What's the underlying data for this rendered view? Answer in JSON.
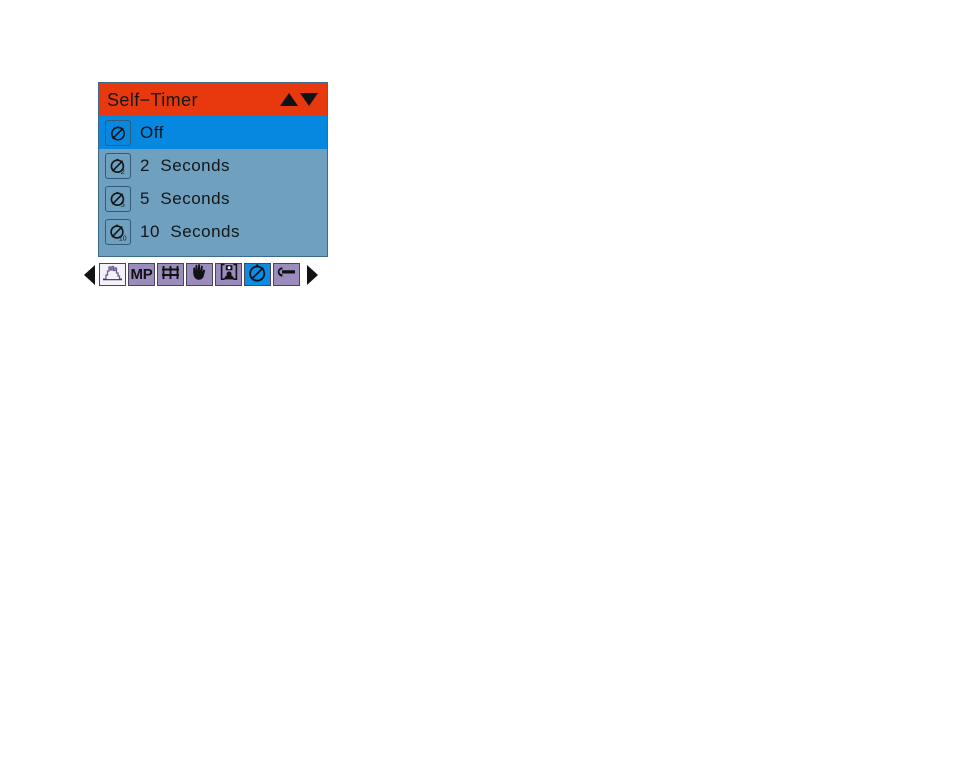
{
  "panel": {
    "title": "Self−Timer",
    "header_color": "#e8380d",
    "body_color": "#6fa0c0",
    "selected_row_color": "#0688e0",
    "scroll_up_icon": "triangle-up-icon",
    "scroll_down_icon": "triangle-down-icon",
    "options": [
      {
        "label": "Off",
        "icon": "self-timer-off-icon",
        "badge": "",
        "selected": true
      },
      {
        "label": "2  Seconds",
        "icon": "self-timer-2s-icon",
        "badge": "2",
        "selected": false
      },
      {
        "label": "5  Seconds",
        "icon": "self-timer-5s-icon",
        "badge": "5",
        "selected": false
      },
      {
        "label": "10  Seconds",
        "icon": "self-timer-10s-icon",
        "badge": "10",
        "selected": false
      }
    ]
  },
  "tab_strip": {
    "prev_label": "◀",
    "next_label": "▶",
    "tabs": [
      {
        "name": "tab-histogram",
        "icon": "histogram-icon",
        "text": "",
        "state": "active-white"
      },
      {
        "name": "tab-mp",
        "icon": "mp-label-icon",
        "text": "MP",
        "state": "normal"
      },
      {
        "name": "tab-rail",
        "icon": "rail-grid-icon",
        "text": "",
        "state": "normal"
      },
      {
        "name": "tab-hand",
        "icon": "hand-icon",
        "text": "",
        "state": "normal"
      },
      {
        "name": "tab-portrait",
        "icon": "portrait-frame-icon",
        "text": "",
        "state": "normal"
      },
      {
        "name": "tab-self-timer",
        "icon": "self-timer-icon",
        "text": "",
        "state": "active-blue"
      },
      {
        "name": "tab-setup",
        "icon": "wrench-icon",
        "text": "",
        "state": "normal"
      }
    ]
  }
}
